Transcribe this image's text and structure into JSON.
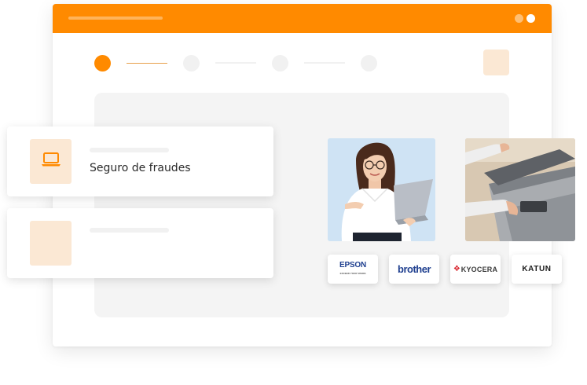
{
  "card_primary": {
    "label": "Seguro de fraudes",
    "icon": "laptop-icon"
  },
  "brands": {
    "epson": "EPSON",
    "epson_tagline": "EXCEED YOUR VISION",
    "brother": "brother",
    "kyocera": "KYOCERA",
    "katun": "KATUN"
  },
  "colors": {
    "accent": "#ff8a00",
    "accent_soft": "#fbe8d4",
    "panel": "#f4f4f4"
  }
}
